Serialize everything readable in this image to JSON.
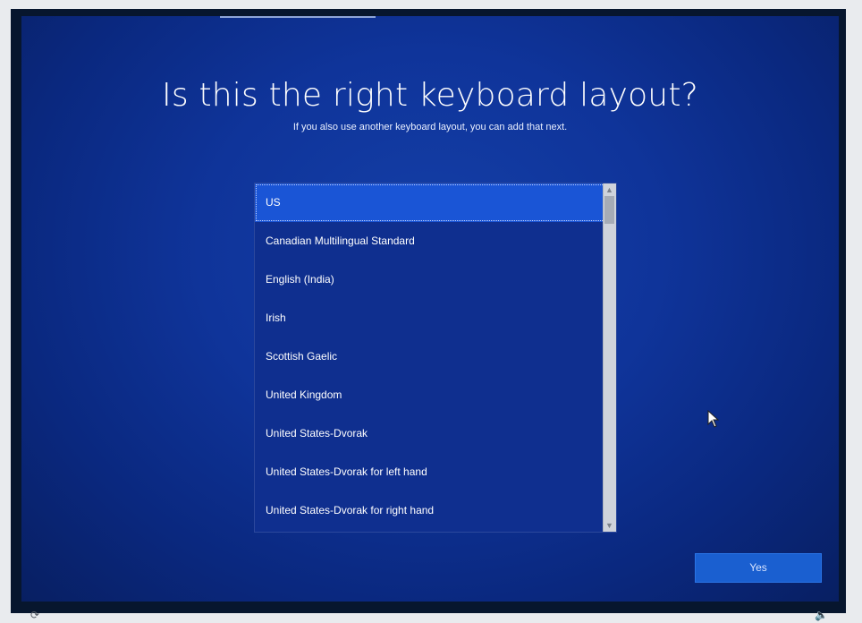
{
  "setup": {
    "title": "Is this the right keyboard layout?",
    "subtitle": "If you also use another keyboard layout, you can add that next."
  },
  "keyboard_list": {
    "selected_index": 0,
    "items": [
      "US",
      "Canadian Multilingual Standard",
      "English (India)",
      "Irish",
      "Scottish Gaelic",
      "United Kingdom",
      "United States-Dvorak",
      "United States-Dvorak for left hand",
      "United States-Dvorak for right hand"
    ],
    "scroll_up_icon": "chevron-up-icon",
    "scroll_down_icon": "chevron-down-icon"
  },
  "actions": {
    "yes_label": "Yes"
  },
  "bottom_icons": {
    "left": "ease-of-access-icon",
    "right": "volume-icon"
  },
  "colors": {
    "background_blue": "#0f349a",
    "selection_blue": "#1a55d6",
    "button_blue": "#1a5fd0"
  }
}
